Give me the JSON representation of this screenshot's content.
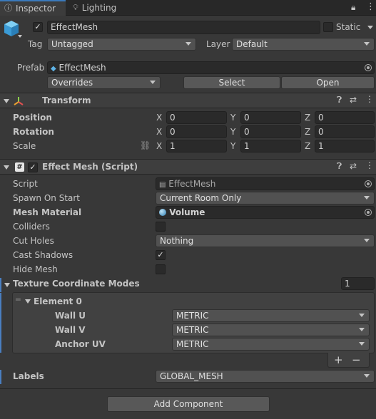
{
  "tabs": [
    {
      "label": "Inspector",
      "icon": "info-icon",
      "active": true
    },
    {
      "label": "Lighting",
      "icon": "lightbulb-icon",
      "active": false
    }
  ],
  "object": {
    "name": "EffectMesh",
    "static_label": "Static",
    "tag_label": "Tag",
    "tag_value": "Untagged",
    "layer_label": "Layer",
    "layer_value": "Default",
    "prefab_label": "Prefab",
    "prefab_value": "EffectMesh",
    "overrides_value": "Overrides",
    "select_label": "Select",
    "open_label": "Open"
  },
  "transform": {
    "title": "Transform",
    "rows": [
      {
        "label": "Position",
        "x": "0",
        "y": "0",
        "z": "0"
      },
      {
        "label": "Rotation",
        "x": "0",
        "y": "0",
        "z": "0"
      },
      {
        "label": "Scale",
        "x": "1",
        "y": "1",
        "z": "1"
      }
    ],
    "axis": {
      "x": "X",
      "y": "Y",
      "z": "Z"
    }
  },
  "effect_mesh": {
    "title": "Effect Mesh (Script)",
    "script_label": "Script",
    "script_value": "EffectMesh",
    "spawn_label": "Spawn On Start",
    "spawn_value": "Current Room Only",
    "material_label": "Mesh Material",
    "material_value": "Volume",
    "colliders_label": "Colliders",
    "colliders_checked": false,
    "cutholes_label": "Cut Holes",
    "cutholes_value": "Nothing",
    "castshadows_label": "Cast Shadows",
    "castshadows_checked": true,
    "hidemesh_label": "Hide Mesh",
    "hidemesh_checked": false,
    "texcoord_label": "Texture Coordinate Modes",
    "texcoord_count": "1",
    "element_label": "Element 0",
    "element_rows": [
      {
        "label": "Wall U",
        "value": "METRIC"
      },
      {
        "label": "Wall V",
        "value": "METRIC"
      },
      {
        "label": "Anchor UV",
        "value": "METRIC"
      }
    ],
    "plus": "+",
    "minus": "−",
    "labels_label": "Labels",
    "labels_value": "GLOBAL_MESH"
  },
  "add_component_label": "Add Component",
  "check_glyph": "✓"
}
